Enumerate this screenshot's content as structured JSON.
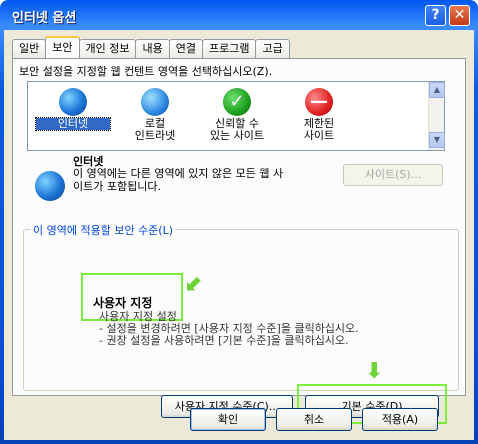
{
  "window": {
    "title": "인터넷 옵션",
    "help": "?",
    "close": "✕"
  },
  "tabs": [
    "일반",
    "보안",
    "개인 정보",
    "내용",
    "연결",
    "프로그램",
    "고급"
  ],
  "instruction": "보안 설정을 지정할 웹 컨텐트 영역을 선택하십시오(Z).",
  "zones": [
    {
      "label": "인터넷",
      "icon": "globe-icon"
    },
    {
      "label": "로컬\n인트라넷",
      "icon": "local-intranet-icon"
    },
    {
      "label": "신뢰할 수\n있는 사이트",
      "icon": "checkmark-icon"
    },
    {
      "label": "제한된\n사이트",
      "icon": "restricted-icon"
    }
  ],
  "scroll": {
    "up": "▲",
    "down": "▼"
  },
  "selected_zone": {
    "name": "인터넷",
    "description": "이 영역에는 다른 영역에 있지 않은 모든 웹 사이트가 포함됩니다.",
    "sites_button": "사이트(S)..."
  },
  "security_level": {
    "group_title": "이 영역에 적용할 보안 수준(L)",
    "level_name": "사용자 지정",
    "lines": [
      "사용자 지정 설정",
      "- 설정을 변경하려면 [사용자 지정 수준]을 클릭하십시오.",
      "- 권장 설정을 사용하려면 [기본 수준]을 클릭하십시오."
    ],
    "custom_button": "사용자 지정 수준(C)...",
    "default_button": "기본 수준(D)"
  },
  "footer": {
    "ok": "확인",
    "cancel": "취소",
    "apply": "적용(A)"
  },
  "colors": {
    "highlight": "#7ced3c",
    "accent": "#0046d5"
  }
}
